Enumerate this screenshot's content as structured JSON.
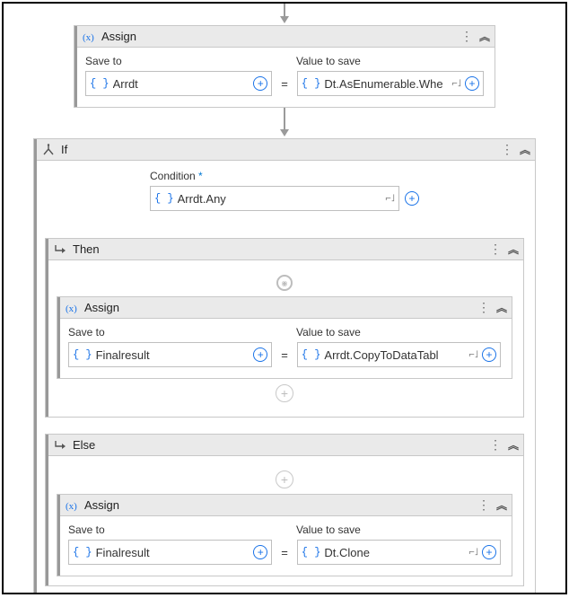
{
  "assign1": {
    "title": "Assign",
    "saveToLbl": "Save to",
    "valueLbl": "Value to save",
    "saveTo": "Arrdt",
    "value": "Dt.AsEnumerable.Whe"
  },
  "if": {
    "title": "If",
    "conditionLbl": "Condition",
    "condition": "Arrdt.Any",
    "then": {
      "title": "Then",
      "assign": {
        "title": "Assign",
        "saveToLbl": "Save to",
        "valueLbl": "Value to save",
        "saveTo": "Finalresult",
        "value": "Arrdt.CopyToDataTabl"
      }
    },
    "else": {
      "title": "Else",
      "assign": {
        "title": "Assign",
        "saveToLbl": "Save to",
        "valueLbl": "Value to save",
        "saveTo": "Finalresult",
        "value": "Dt.Clone"
      }
    }
  },
  "glyph": {
    "asterisk": "*",
    "equals": "=",
    "braces": "{ }"
  }
}
